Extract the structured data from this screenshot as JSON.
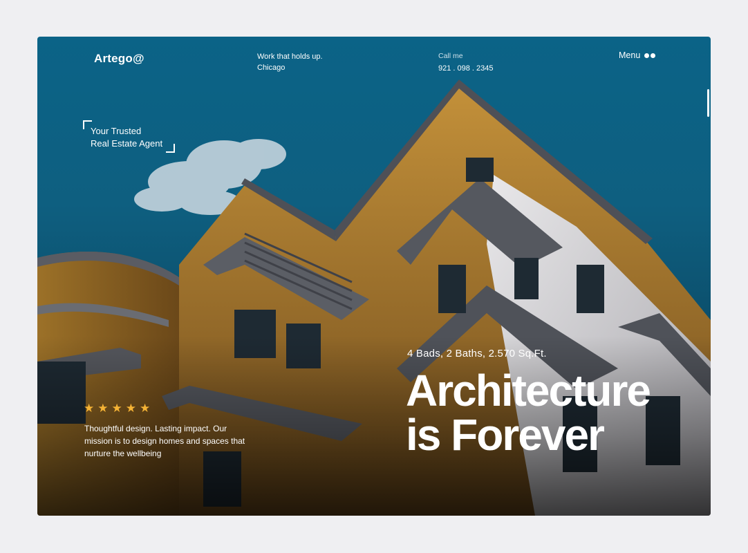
{
  "nav": {
    "logo": "Artego@",
    "tagline_line1": "Work that holds up.",
    "tagline_line2": "Chicago",
    "call_label": "Call me",
    "phone": "921 . 098 . 2345",
    "menu_label": "Menu"
  },
  "hero": {
    "trusted_line1": "Your Trusted",
    "trusted_line2": "Real Estate Agent",
    "rating": 5,
    "mission": "Thoughtful design. Lasting impact. Our mission is to design homes and spaces that nurture the wellbeing",
    "specs": "4 Bads,  2 Baths,  2.570 Sq.Ft.",
    "headline_line1": "Architecture",
    "headline_line2": "is Forever"
  },
  "colors": {
    "sky": "#0b6387",
    "star": "#f5b335",
    "facade": "#b8862e",
    "text": "#ffffff"
  },
  "icons": [
    "menu-dots-icon",
    "star-icon",
    "frame-corner-icon"
  ]
}
